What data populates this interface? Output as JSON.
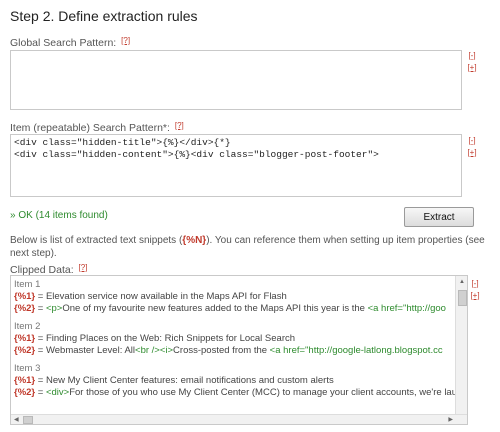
{
  "step_title": "Step 2. Define extraction rules",
  "global": {
    "label": "Global Search Pattern:",
    "help": "[?]",
    "expand": "[-]",
    "collapse": "[+]",
    "value": ""
  },
  "item": {
    "label": "Item (repeatable) Search Pattern*:",
    "help": "[?]",
    "expand": "[-]",
    "collapse": "[+]",
    "lines": [
      "<div class=\"hidden-title\">{%}</div>{*}",
      "<div class=\"hidden-content\">{%}<div class=\"blogger-post-footer\">"
    ]
  },
  "status": "» OK (14 items found)",
  "extract_label": "Extract",
  "description": {
    "before": "Below is list of extracted text snippets (",
    "token": "{%N}",
    "after": "). You can reference them when setting up item properties (see next step)."
  },
  "clipped": {
    "label": "Clipped Data:",
    "help": "[?]",
    "expand": "[-]",
    "collapse": "[+]",
    "items": [
      {
        "title": "Item 1",
        "rows": [
          {
            "key": "{%1}",
            "eq": " = ",
            "text": "Elevation service now available in the Maps API for Flash",
            "tag": "",
            "rest": "",
            "link": ""
          },
          {
            "key": "{%2}",
            "eq": " = ",
            "text": "",
            "tag": "<p>",
            "rest": "One of my favourite new features added to the Maps API this year is the ",
            "link": "<a href=\"http://goo"
          }
        ]
      },
      {
        "title": "Item 2",
        "rows": [
          {
            "key": "{%1}",
            "eq": " = ",
            "text": "Finding Places on the Web: Rich Snippets for Local Search",
            "tag": "",
            "rest": "",
            "link": ""
          },
          {
            "key": "{%2}",
            "eq": " = ",
            "text": "Webmaster Level: All",
            "tag": "<br /><i>",
            "rest": "Cross-posted from the ",
            "link": "<a href=\"http://google-latlong.blogspot.cc"
          }
        ]
      },
      {
        "title": "Item 3",
        "rows": [
          {
            "key": "{%1}",
            "eq": " = ",
            "text": "New My Client Center features: email notifications and custom alerts",
            "tag": "",
            "rest": "",
            "link": ""
          },
          {
            "key": "{%2}",
            "eq": " = ",
            "text": "",
            "tag": "<div>",
            "rest": "For those of you who use My Client Center (MCC) to manage your client accounts, we're laun",
            "link": ""
          }
        ]
      }
    ]
  }
}
